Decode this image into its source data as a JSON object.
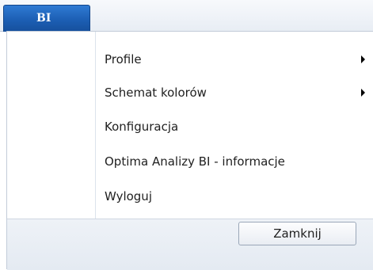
{
  "app_tab": {
    "label": "BI"
  },
  "menu": {
    "items": [
      {
        "label": "Profile",
        "has_submenu": true
      },
      {
        "label": "Schemat kolorów",
        "has_submenu": true
      },
      {
        "label": "Konfiguracja",
        "has_submenu": false
      },
      {
        "label": "Optima Analizy BI - informacje",
        "has_submenu": false
      },
      {
        "label": "Wyloguj",
        "has_submenu": false
      }
    ]
  },
  "footer": {
    "close_label": "Zamknij"
  },
  "colors": {
    "tab_blue": "#1c5fb4",
    "footer_bg": "#e9eef5"
  }
}
